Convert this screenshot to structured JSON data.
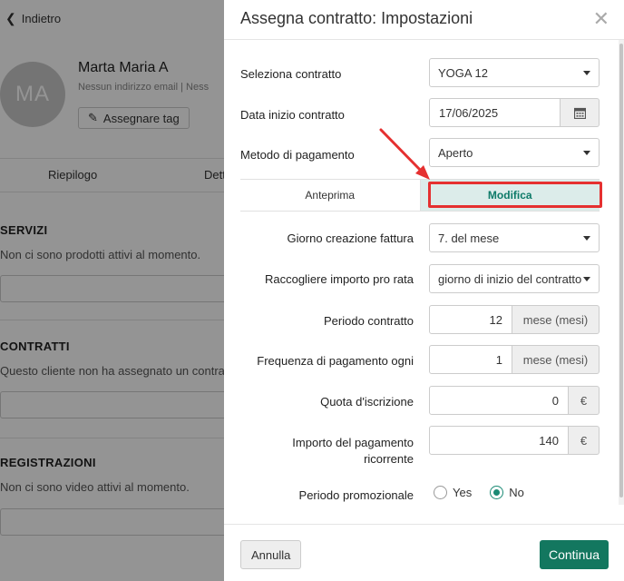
{
  "background": {
    "back_label": "Indietro",
    "avatar_initials": "MA",
    "client_name": "Marta Maria A",
    "client_email": "Nessun indirizzo email  |  Ness",
    "tag_button": "Assegnare tag",
    "tabs": [
      "Riepilogo",
      "Dett"
    ],
    "sections": [
      {
        "title": "SERVIZI",
        "text": "Non ci sono prodotti attivi al momento."
      },
      {
        "title": "CONTRATTI",
        "text": "Questo cliente non ha assegnato un contra"
      },
      {
        "title": "REGISTRAZIONI",
        "text": "Non ci sono video attivi al momento."
      }
    ]
  },
  "modal": {
    "title": "Assegna contratto: Impostazioni",
    "fields": {
      "contract": {
        "label": "Seleziona contratto",
        "value": "YOGA 12"
      },
      "start_date": {
        "label": "Data inizio contratto",
        "value": "17/06/2025"
      },
      "payment_method": {
        "label": "Metodo di pagamento",
        "value": "Aperto"
      }
    },
    "tabs": {
      "preview": "Anteprima",
      "edit": "Modifica"
    },
    "settings": {
      "invoice_day": {
        "label": "Giorno creazione fattura",
        "value": "7. del mese"
      },
      "prorata": {
        "label": "Raccogliere importo pro rata",
        "value": "giorno di inizio del contratto"
      },
      "period": {
        "label": "Periodo contratto",
        "value": "12",
        "unit": "mese (mesi)"
      },
      "frequency": {
        "label": "Frequenza di pagamento ogni",
        "value": "1",
        "unit": "mese (mesi)"
      },
      "fee": {
        "label": "Quota d'iscrizione",
        "value": "0",
        "unit": "€"
      },
      "recurring": {
        "label": "Importo del pagamento ricorrente",
        "value": "140",
        "unit": "€"
      },
      "promo": {
        "label": "Periodo promozionale",
        "options": [
          "Yes",
          "No"
        ],
        "selected": "No"
      }
    },
    "buttons": {
      "cancel": "Annulla",
      "continue": "Continua"
    }
  },
  "colors": {
    "accent": "#13775f",
    "highlight": "#e53030",
    "active_tab_bg": "#dcecea"
  }
}
